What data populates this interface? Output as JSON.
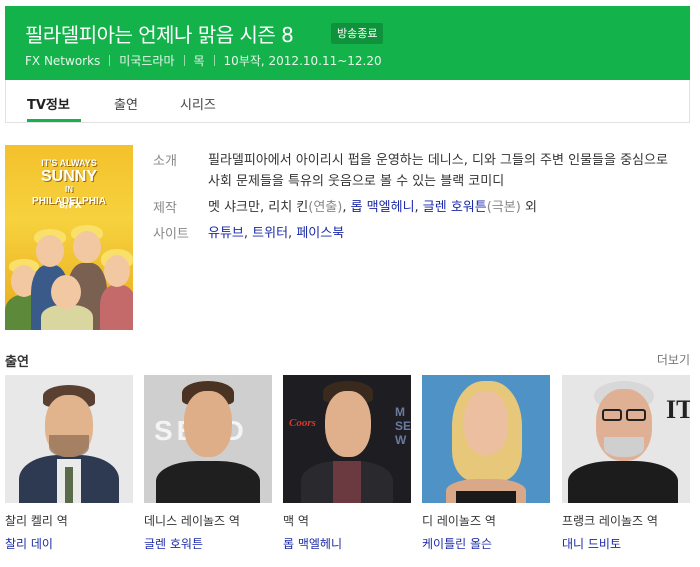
{
  "header": {
    "title": "필라델피아는 언제나 맑음 시즌 8",
    "badge": "방송종료",
    "meta": [
      "FX Networks",
      "미국드라마",
      "목",
      "10부작, 2012.10.11~12.20"
    ]
  },
  "tabs": [
    {
      "label": "TV정보",
      "active": true
    },
    {
      "label": "출연",
      "active": false
    },
    {
      "label": "시리즈",
      "active": false
    }
  ],
  "poster": {
    "title_lines": [
      "IT'S ALWAYS",
      "SUNNY",
      "IN",
      "PHILADELPHIA"
    ],
    "network": "8/FX"
  },
  "info": {
    "intro_label": "소개",
    "intro_text": "필라델피아에서 아이리시 펍을 운영하는 데니스, 디와 그들의 주변 인물들을 중심으로 사회 문제들을 특유의 웃음으로 볼 수 있는 블랙 코미디",
    "production_label": "제작",
    "production": {
      "plain1": "멧 샤크만, 리치 킨",
      "role1": "(연출)",
      "sep1": ", ",
      "link1": "롭 맥엘헤니",
      "sep2": ", ",
      "link2": "글렌 호워튼",
      "role2": "(극본)",
      "suffix": " 외"
    },
    "site_label": "사이트",
    "sites": [
      "유튜브",
      "트위터",
      "페이스북"
    ],
    "site_sep": ", "
  },
  "cast": {
    "heading": "출연",
    "more": "더보기",
    "members": [
      {
        "role": "찰리 켈리 역",
        "actor": "찰리 데이"
      },
      {
        "role": "데니스 레이놀즈 역",
        "actor": "글렌 호워튼"
      },
      {
        "role": "맥 역",
        "actor": "롭 맥엘헤니"
      },
      {
        "role": "디 레이놀즈 역",
        "actor": "케이틀린 올슨"
      },
      {
        "role": "프랭크 레이놀즈 역",
        "actor": "대니 드비토"
      }
    ]
  },
  "colors": {
    "brand_green": "#14b24a",
    "link_blue": "#1b2aa8"
  }
}
